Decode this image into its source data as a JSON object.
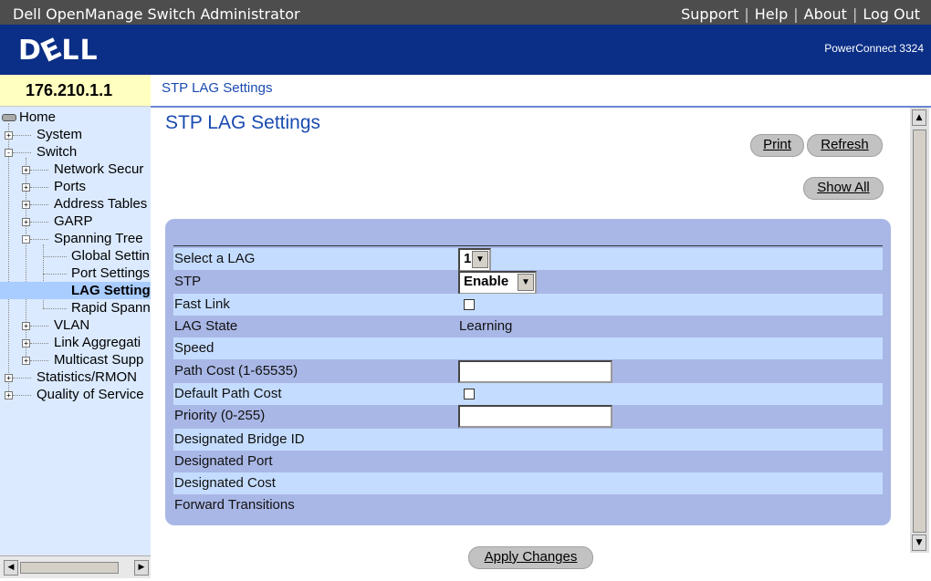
{
  "titlebar": {
    "app_name": "Dell OpenManage Switch Administrator",
    "links": [
      "Support",
      "Help",
      "About",
      "Log Out"
    ]
  },
  "banner": {
    "logo": "DELL",
    "product": "PowerConnect 3324"
  },
  "ip": "176.210.1.1",
  "breadcrumb": "STP LAG Settings",
  "tree": {
    "home": "Home",
    "system": "System",
    "switch": "Switch",
    "network_security": "Network Secur",
    "ports": "Ports",
    "address_tables": "Address Tables",
    "garp": "GARP",
    "spanning_tree": "Spanning Tree",
    "global_settings": "Global Settin",
    "port_settings": "Port Settings",
    "lag_settings": "LAG Settings",
    "rapid_spanning": "Rapid Spanni",
    "vlan": "VLAN",
    "link_aggregation": "Link Aggregati",
    "multicast_support": "Multicast Supp",
    "statistics": "Statistics/RMON",
    "qos": "Quality of Service"
  },
  "page": {
    "title": "STP LAG Settings",
    "print": "Print",
    "refresh": "Refresh",
    "show_all": "Show All",
    "apply": "Apply Changes"
  },
  "form": {
    "select_lag": {
      "label": "Select a LAG",
      "value": "1"
    },
    "stp": {
      "label": "STP",
      "value": "Enable"
    },
    "fast_link": {
      "label": "Fast Link"
    },
    "lag_state": {
      "label": "LAG State",
      "value": "Learning"
    },
    "speed": {
      "label": "Speed",
      "value": ""
    },
    "path_cost": {
      "label": "Path Cost (1-65535)",
      "value": ""
    },
    "default_path_cost": {
      "label": "Default Path Cost"
    },
    "priority": {
      "label": "Priority (0-255)",
      "value": ""
    },
    "designated_bridge_id": {
      "label": "Designated Bridge ID",
      "value": ""
    },
    "designated_port": {
      "label": "Designated Port",
      "value": ""
    },
    "designated_cost": {
      "label": "Designated Cost",
      "value": ""
    },
    "forward_transitions": {
      "label": "Forward Transitions",
      "value": ""
    }
  },
  "colors": {
    "banner": "#0b2f86",
    "tree_bg": "#dbeaff",
    "panel": "#a9b7e6",
    "row_light": "#c4dcff",
    "title": "#1a4bb0"
  }
}
